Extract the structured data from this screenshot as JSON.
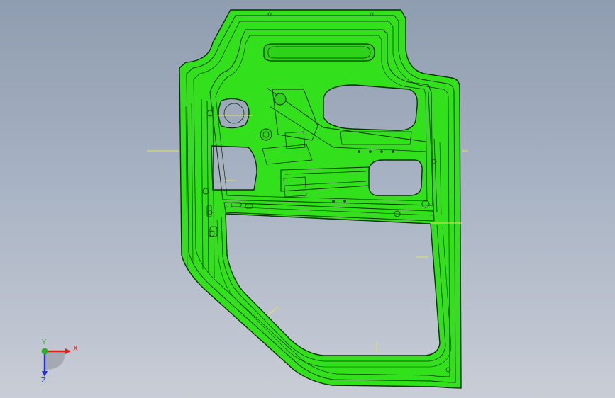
{
  "viewport": {
    "background_top": "#8f9db0",
    "background_bottom": "#c9cdd6",
    "part_fill": "#33e01c",
    "part_edge": "#0b2f07",
    "sketch_color": "#e6e05a"
  },
  "triad": {
    "x_label": "X",
    "y_label": "Y",
    "z_label": "Z",
    "x_color": "#e0201c",
    "y_color": "#25b32a",
    "z_color": "#2233d6"
  }
}
